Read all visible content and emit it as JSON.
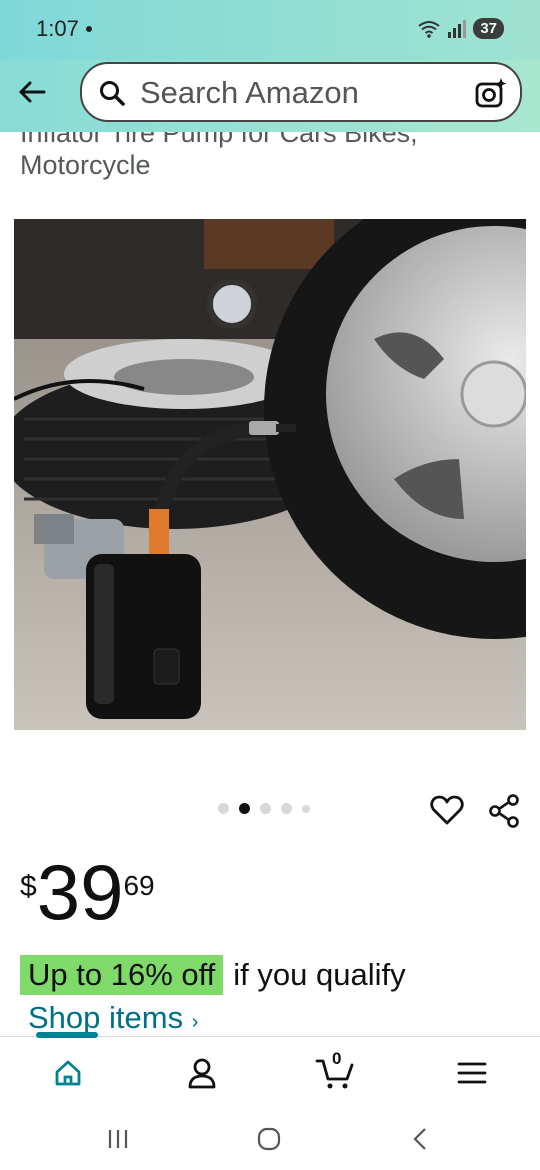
{
  "status_bar": {
    "time": "1:07",
    "battery": "37"
  },
  "search": {
    "placeholder": "Search Amazon"
  },
  "product": {
    "title_line1": "Inflator Tire Pump for Cars Bikes,",
    "title_line2": "Motorcycle",
    "image_count": 5,
    "active_image_index": 1
  },
  "price": {
    "symbol": "$",
    "whole": "39",
    "fraction": "69"
  },
  "deal": {
    "badge": "Up to 16% off",
    "text": "if you qualify"
  },
  "shop": {
    "label": "Shop items",
    "chevron": "›"
  },
  "cart": {
    "count": "0"
  },
  "colors": {
    "accent": "#008296",
    "deal_green": "#7fda69",
    "link": "#007185",
    "header_teal": "#87dcd7"
  },
  "icons": {
    "back": "back-arrow-icon",
    "search": "search-icon",
    "camera": "camera-lens-icon",
    "heart": "heart-icon",
    "share": "share-icon",
    "home": "home-icon",
    "account": "account-icon",
    "cart": "cart-icon",
    "menu": "menu-icon"
  }
}
